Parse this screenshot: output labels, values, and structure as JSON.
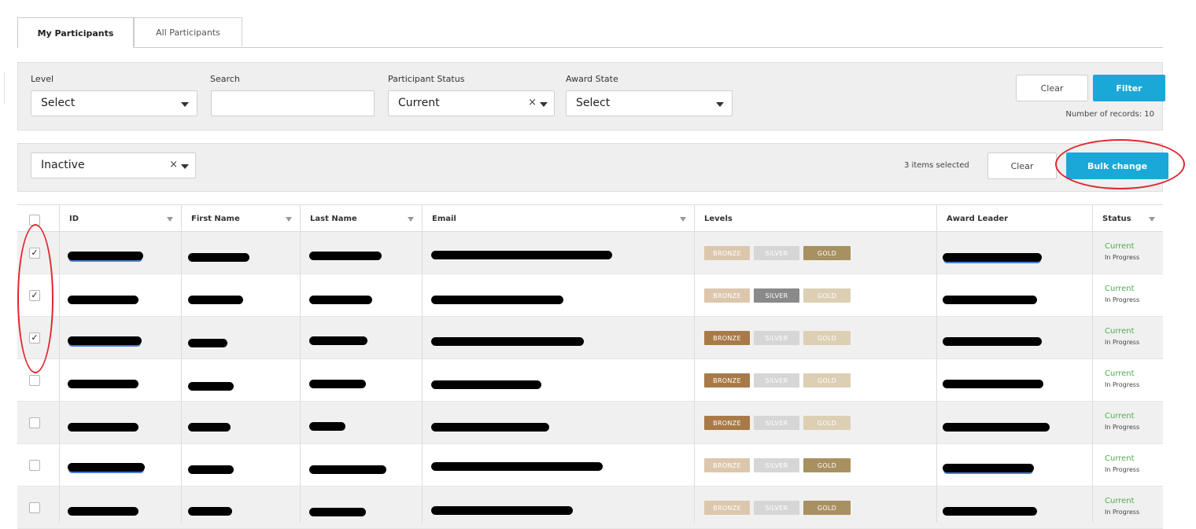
{
  "tabs": [
    {
      "label": "My Participants",
      "active": true
    },
    {
      "label": "All Participants",
      "active": false
    }
  ],
  "filters": {
    "level": {
      "label": "Level",
      "value": "Select"
    },
    "search": {
      "label": "Search",
      "value": ""
    },
    "participant_status": {
      "label": "Participant Status",
      "value": "Current"
    },
    "award_state": {
      "label": "Award State",
      "value": "Select"
    },
    "clear_label": "Clear",
    "filter_label": "Filter",
    "records_text": "Number of records: 10"
  },
  "bulk": {
    "status_value": "Inactive",
    "selected_text": "3 items selected",
    "clear_label": "Clear",
    "bulk_change_label": "Bulk change"
  },
  "table": {
    "columns": [
      "ID",
      "First Name",
      "Last Name",
      "Email",
      "Levels",
      "Award Leader",
      "Status"
    ],
    "level_labels": [
      "BRONZE",
      "SILVER",
      "GOLD"
    ],
    "rows": [
      {
        "checked": true,
        "active_level": "GOLD",
        "status": "Current",
        "sub_status": "In Progress"
      },
      {
        "checked": true,
        "active_level": "SILVER",
        "status": "Current",
        "sub_status": "In Progress"
      },
      {
        "checked": true,
        "active_level": "BRONZE",
        "status": "Current",
        "sub_status": "In Progress"
      },
      {
        "checked": false,
        "active_level": "BRONZE",
        "status": "Current",
        "sub_status": "In Progress"
      },
      {
        "checked": false,
        "active_level": "BRONZE",
        "status": "Current",
        "sub_status": "In Progress"
      },
      {
        "checked": false,
        "active_level": "GOLD",
        "status": "Current",
        "sub_status": "In Progress"
      },
      {
        "checked": false,
        "active_level": "GOLD",
        "status": "Current",
        "sub_status": "In Progress"
      }
    ]
  },
  "colors": {
    "accent": "#1aa8d8",
    "bronze_active": "#a87a48",
    "bronze_inactive": "#dcc7ad",
    "silver_active": "#8a8a8a",
    "silver_inactive": "#d6d6d6",
    "gold_active": "#a89060",
    "gold_inactive": "#dccfb4",
    "status_current": "#4caf50",
    "annotation": "#e1262d"
  }
}
